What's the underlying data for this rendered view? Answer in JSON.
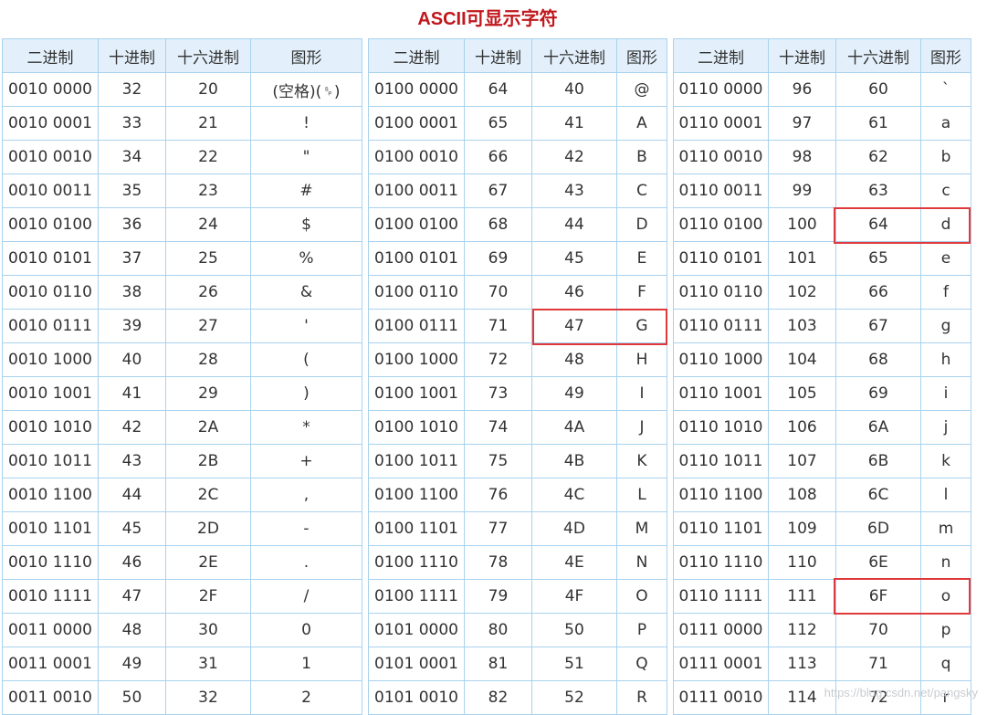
{
  "title": "ASCII可显示字符",
  "headers": [
    "二进制",
    "十进制",
    "十六进制",
    "图形"
  ],
  "tables": [
    {
      "rows": [
        [
          "0010 0000",
          "32",
          "20",
          "(空格)(␠)"
        ],
        [
          "0010 0001",
          "33",
          "21",
          "!"
        ],
        [
          "0010 0010",
          "34",
          "22",
          "\""
        ],
        [
          "0010 0011",
          "35",
          "23",
          "#"
        ],
        [
          "0010 0100",
          "36",
          "24",
          "$"
        ],
        [
          "0010 0101",
          "37",
          "25",
          "%"
        ],
        [
          "0010 0110",
          "38",
          "26",
          "&"
        ],
        [
          "0010 0111",
          "39",
          "27",
          "'"
        ],
        [
          "0010 1000",
          "40",
          "28",
          "("
        ],
        [
          "0010 1001",
          "41",
          "29",
          ")"
        ],
        [
          "0010 1010",
          "42",
          "2A",
          "*"
        ],
        [
          "0010 1011",
          "43",
          "2B",
          "+"
        ],
        [
          "0010 1100",
          "44",
          "2C",
          ","
        ],
        [
          "0010 1101",
          "45",
          "2D",
          "-"
        ],
        [
          "0010 1110",
          "46",
          "2E",
          "."
        ],
        [
          "0010 1111",
          "47",
          "2F",
          "/"
        ],
        [
          "0011 0000",
          "48",
          "30",
          "0"
        ],
        [
          "0011 0001",
          "49",
          "31",
          "1"
        ],
        [
          "0011 0010",
          "50",
          "32",
          "2"
        ]
      ]
    },
    {
      "rows": [
        [
          "0100 0000",
          "64",
          "40",
          "@"
        ],
        [
          "0100 0001",
          "65",
          "41",
          "A"
        ],
        [
          "0100 0010",
          "66",
          "42",
          "B"
        ],
        [
          "0100 0011",
          "67",
          "43",
          "C"
        ],
        [
          "0100 0100",
          "68",
          "44",
          "D"
        ],
        [
          "0100 0101",
          "69",
          "45",
          "E"
        ],
        [
          "0100 0110",
          "70",
          "46",
          "F"
        ],
        [
          "0100 0111",
          "71",
          "47",
          "G"
        ],
        [
          "0100 1000",
          "72",
          "48",
          "H"
        ],
        [
          "0100 1001",
          "73",
          "49",
          "I"
        ],
        [
          "0100 1010",
          "74",
          "4A",
          "J"
        ],
        [
          "0100 1011",
          "75",
          "4B",
          "K"
        ],
        [
          "0100 1100",
          "76",
          "4C",
          "L"
        ],
        [
          "0100 1101",
          "77",
          "4D",
          "M"
        ],
        [
          "0100 1110",
          "78",
          "4E",
          "N"
        ],
        [
          "0100 1111",
          "79",
          "4F",
          "O"
        ],
        [
          "0101 0000",
          "80",
          "50",
          "P"
        ],
        [
          "0101 0001",
          "81",
          "51",
          "Q"
        ],
        [
          "0101 0010",
          "82",
          "52",
          "R"
        ]
      ]
    },
    {
      "rows": [
        [
          "0110 0000",
          "96",
          "60",
          "`"
        ],
        [
          "0110 0001",
          "97",
          "61",
          "a"
        ],
        [
          "0110 0010",
          "98",
          "62",
          "b"
        ],
        [
          "0110 0011",
          "99",
          "63",
          "c"
        ],
        [
          "0110 0100",
          "100",
          "64",
          "d"
        ],
        [
          "0110 0101",
          "101",
          "65",
          "e"
        ],
        [
          "0110 0110",
          "102",
          "66",
          "f"
        ],
        [
          "0110 0111",
          "103",
          "67",
          "g"
        ],
        [
          "0110 1000",
          "104",
          "68",
          "h"
        ],
        [
          "0110 1001",
          "105",
          "69",
          "i"
        ],
        [
          "0110 1010",
          "106",
          "6A",
          "j"
        ],
        [
          "0110 1011",
          "107",
          "6B",
          "k"
        ],
        [
          "0110 1100",
          "108",
          "6C",
          "l"
        ],
        [
          "0110 1101",
          "109",
          "6D",
          "m"
        ],
        [
          "0110 1110",
          "110",
          "6E",
          "n"
        ],
        [
          "0110 1111",
          "111",
          "6F",
          "o"
        ],
        [
          "0111 0000",
          "112",
          "70",
          "p"
        ],
        [
          "0111 0001",
          "113",
          "71",
          "q"
        ],
        [
          "0111 0010",
          "114",
          "72",
          "r"
        ]
      ]
    }
  ],
  "highlighted_cells": [
    {
      "table": 1,
      "row": 7,
      "chars": [
        "47",
        "G"
      ]
    },
    {
      "table": 2,
      "row": 4,
      "chars": [
        "64",
        "d"
      ]
    },
    {
      "table": 2,
      "row": 15,
      "chars": [
        "6F",
        "o"
      ]
    }
  ],
  "watermark": "https://blog.csdn.net/pangsky",
  "colors": {
    "title": "#c0171c",
    "header_bg": "#e3f0fb",
    "border": "#a8d2ee",
    "highlight": "#e0393c"
  }
}
